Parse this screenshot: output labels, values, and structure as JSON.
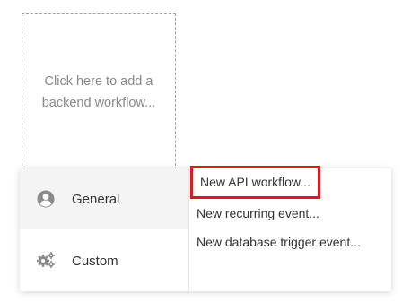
{
  "placeholder": {
    "text": "Click here to add a backend workflow..."
  },
  "menu": {
    "categories": [
      {
        "label": "General",
        "icon": "user-circle-icon"
      },
      {
        "label": "Custom",
        "icon": "gears-icon"
      }
    ],
    "options": [
      {
        "label": "New API workflow..."
      },
      {
        "label": "New recurring event..."
      },
      {
        "label": "New database trigger event..."
      }
    ]
  },
  "colors": {
    "highlight_border": "#e0181e",
    "active_category_bg": "#f4f4f4",
    "placeholder_text": "#888888",
    "icon": "#8a8a8a"
  }
}
